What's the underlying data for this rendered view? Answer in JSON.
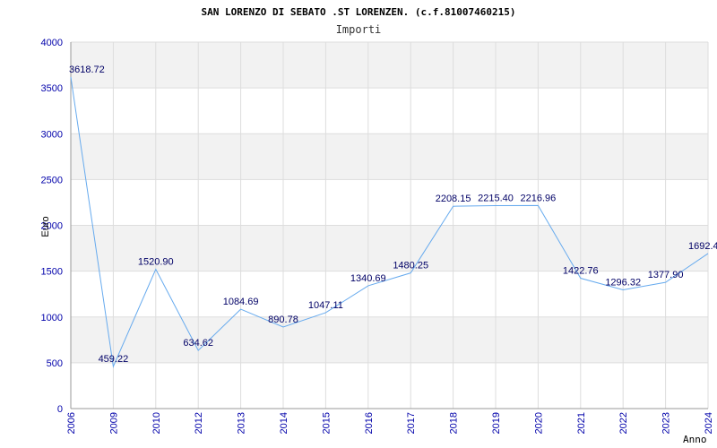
{
  "chart_data": {
    "type": "line",
    "title": "SAN LORENZO DI SEBATO .ST LORENZEN. (c.f.81007460215)",
    "subtitle": "Importi",
    "xlabel": "Anno",
    "ylabel": "Euro",
    "ylim": [
      0,
      4000
    ],
    "yticks": [
      0,
      500,
      1000,
      1500,
      2000,
      2500,
      3000,
      3500,
      4000
    ],
    "grid": true,
    "categories": [
      "2006",
      "2009",
      "2010",
      "2012",
      "2013",
      "2014",
      "2015",
      "2016",
      "2017",
      "2018",
      "2019",
      "2020",
      "2021",
      "2022",
      "2023",
      "2024"
    ],
    "values": [
      3618.72,
      459.22,
      1520.9,
      634.62,
      1084.69,
      890.78,
      1047.11,
      1340.69,
      1480.25,
      2208.15,
      2215.4,
      2216.96,
      1422.76,
      1296.32,
      1377.9,
      1692.4
    ],
    "value_labels": [
      "3618.72",
      "459.22",
      "1520.90",
      "634.62",
      "1084.69",
      "890.78",
      "1047.11",
      "1340.69",
      "1480.25",
      "2208.15",
      "2215.40",
      "2216.96",
      "1422.76",
      "1296.32",
      "1377.90",
      "1692.4"
    ],
    "colors": {
      "line": "#66aaee",
      "band": "#f2f2f2",
      "grid": "#dddddd",
      "tick_text": "#0000aa",
      "label_text": "#000066"
    }
  }
}
